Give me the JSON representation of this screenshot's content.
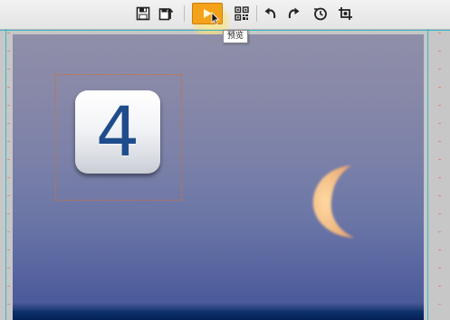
{
  "toolbar": {
    "buttons": [
      {
        "id": "save",
        "icon": "save-icon"
      },
      {
        "id": "publish",
        "icon": "export-icon"
      },
      {
        "id": "preview",
        "icon": "play-icon",
        "active": true
      },
      {
        "id": "qrcode",
        "icon": "qr-code-icon"
      },
      {
        "id": "undo",
        "icon": "undo-icon"
      },
      {
        "id": "redo",
        "icon": "redo-icon"
      },
      {
        "id": "history",
        "icon": "history-icon"
      },
      {
        "id": "screenshot",
        "icon": "crop-screen-icon"
      }
    ],
    "tooltip": "预览",
    "accent_color": "#f4a21a"
  },
  "canvas": {
    "element": {
      "digit": "4",
      "digit_color": "#1f4d8c"
    },
    "background_image": "moon-sky-photo",
    "moon_color": "#f2c98a",
    "guide_color": "#35b7c9"
  }
}
